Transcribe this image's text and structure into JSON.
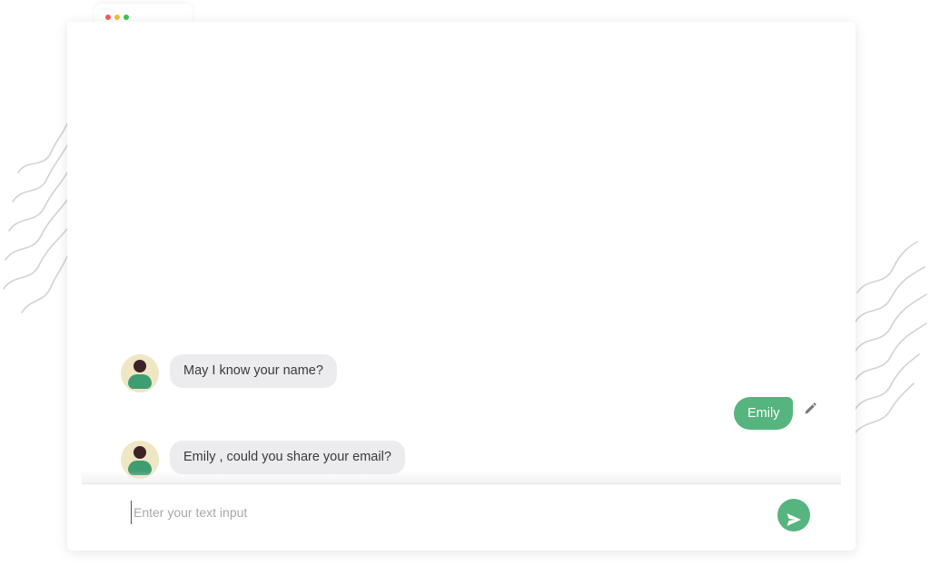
{
  "window": {
    "controls": [
      "close",
      "minimize",
      "maximize"
    ]
  },
  "colors": {
    "dot_red": "#f25f57",
    "dot_yellow": "#f6bd3b",
    "dot_green": "#3fc650",
    "bot_bubble": "#ececee",
    "user_bubble": "#56b47f",
    "send_button": "#56b47f",
    "squiggle": "#d3d3d3"
  },
  "chat": {
    "messages": [
      {
        "sender": "bot",
        "avatar_icon": "user-avatar-icon",
        "text": "May I know your name?"
      },
      {
        "sender": "user",
        "text": "Emily",
        "action_icon": "pencil-edit-icon"
      },
      {
        "sender": "bot",
        "avatar_icon": "user-avatar-icon",
        "text": "Emily , could you share your email?"
      }
    ]
  },
  "composer": {
    "placeholder": "Enter your text input",
    "value": "",
    "send_icon": "paper-plane-send-icon"
  }
}
